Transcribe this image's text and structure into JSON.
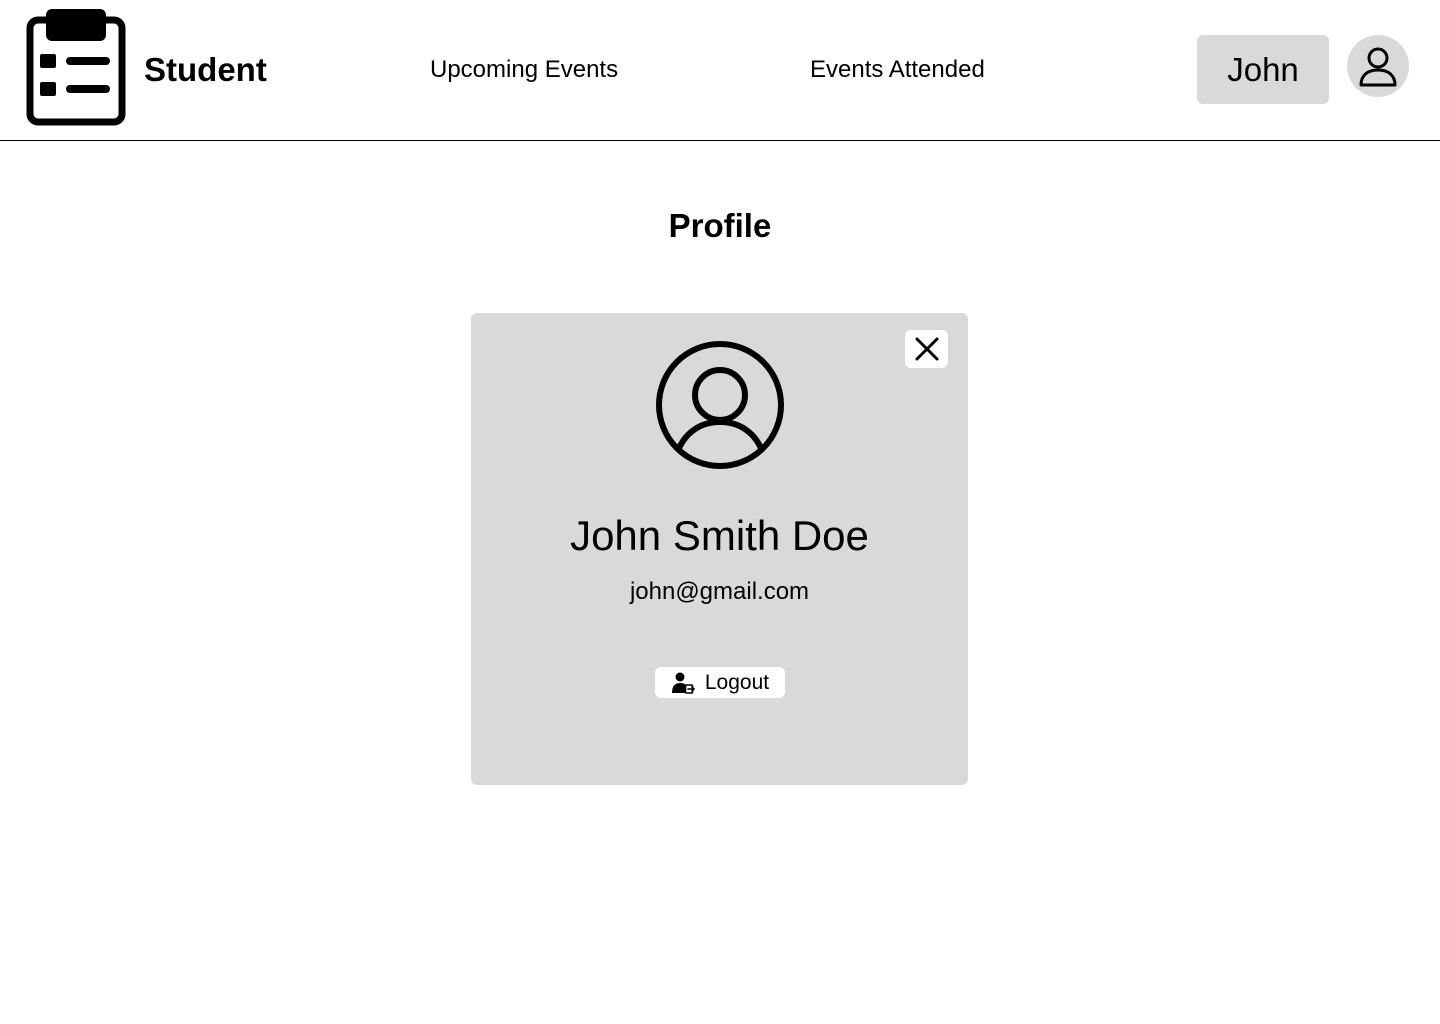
{
  "header": {
    "logo_icon": "clipboard-list-icon",
    "brand": "Student",
    "nav": [
      {
        "label": "Upcoming Events"
      },
      {
        "label": "Events Attended"
      }
    ],
    "user_button_label": "John",
    "avatar_icon": "user-icon"
  },
  "page": {
    "title": "Profile"
  },
  "profile_card": {
    "close_icon": "close-icon",
    "avatar_icon": "user-circle-icon",
    "name": "John Smith Doe",
    "email": "john@gmail.com",
    "logout_label": "Logout",
    "logout_icon": "user-logout-icon"
  },
  "colors": {
    "panel": "#d9d9d9",
    "background": "#ffffff",
    "text": "#000000"
  }
}
